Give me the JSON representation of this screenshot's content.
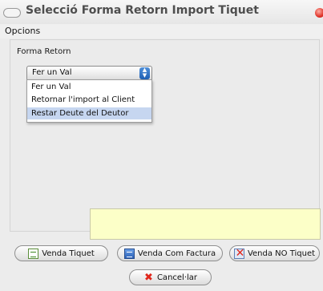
{
  "window": {
    "title": "Selecció Forma Retorn Import Tiquet"
  },
  "menu": {
    "opcions": "Opcions"
  },
  "form": {
    "group_label": "Forma Retorn",
    "select_value": "Fer un Val",
    "options": [
      "Fer un Val",
      "Retornar l'import al Client",
      "Restar Deute del Deutor"
    ],
    "highlighted_option": "Restar Deute del Deutor"
  },
  "buttons": {
    "venda_tiquet": "Venda Tiquet",
    "venda_com_factura": "Venda Com Factura",
    "venda_no_tiquet": "Venda NO Tiquet",
    "cancelar": "Cancel·lar"
  },
  "icons": {
    "close": "close-icon",
    "venda_tiquet": "ticket-icon",
    "venda_com_factura": "invoice-icon",
    "venda_no_tiquet": "no-ticket-icon",
    "cancelar": "cancel-x-icon",
    "select": "updown-arrows-icon"
  },
  "colors": {
    "notice_bg": "#fcffc8",
    "close": "#e0342a",
    "select_arrows": "#2a6cc4",
    "highlight": "#c6d6f0"
  }
}
